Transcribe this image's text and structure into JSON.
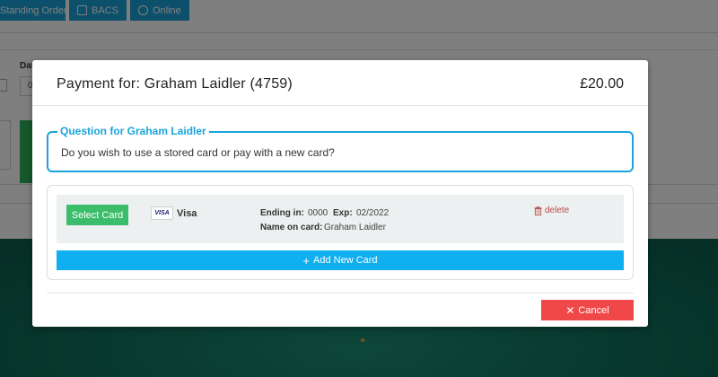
{
  "background": {
    "tabs": [
      {
        "label": "Standing Order",
        "icon": "none"
      },
      {
        "label": "BACS",
        "icon": "calendar-icon"
      },
      {
        "label": "Online",
        "icon": "globe-icon"
      }
    ],
    "date_label": "Dat",
    "date_input_value": "0"
  },
  "modal": {
    "title": "Payment for: Graham Laidler (4759)",
    "amount": "£20.00",
    "question": {
      "legend": "Question for Graham Laidler",
      "text": "Do you wish to use a stored card or pay with a new card?"
    },
    "card": {
      "select_label": "Select Card",
      "brand_logo_text": "VISA",
      "brand_label": "Visa",
      "ending_label": "Ending in:",
      "ending_value": "0000",
      "exp_label": "Exp:",
      "exp_value": "02/2022",
      "name_label": "Name on card:",
      "name_value": "Graham Laidler",
      "delete_label": "delete"
    },
    "add_card_label": "Add New Card",
    "cancel_label": "Cancel"
  },
  "colors": {
    "accent_blue": "#1aa3dd",
    "add_card_blue": "#0faff0",
    "select_green": "#3cbd6b",
    "cancel_red": "#f04848",
    "delete_red": "#b94a48"
  }
}
